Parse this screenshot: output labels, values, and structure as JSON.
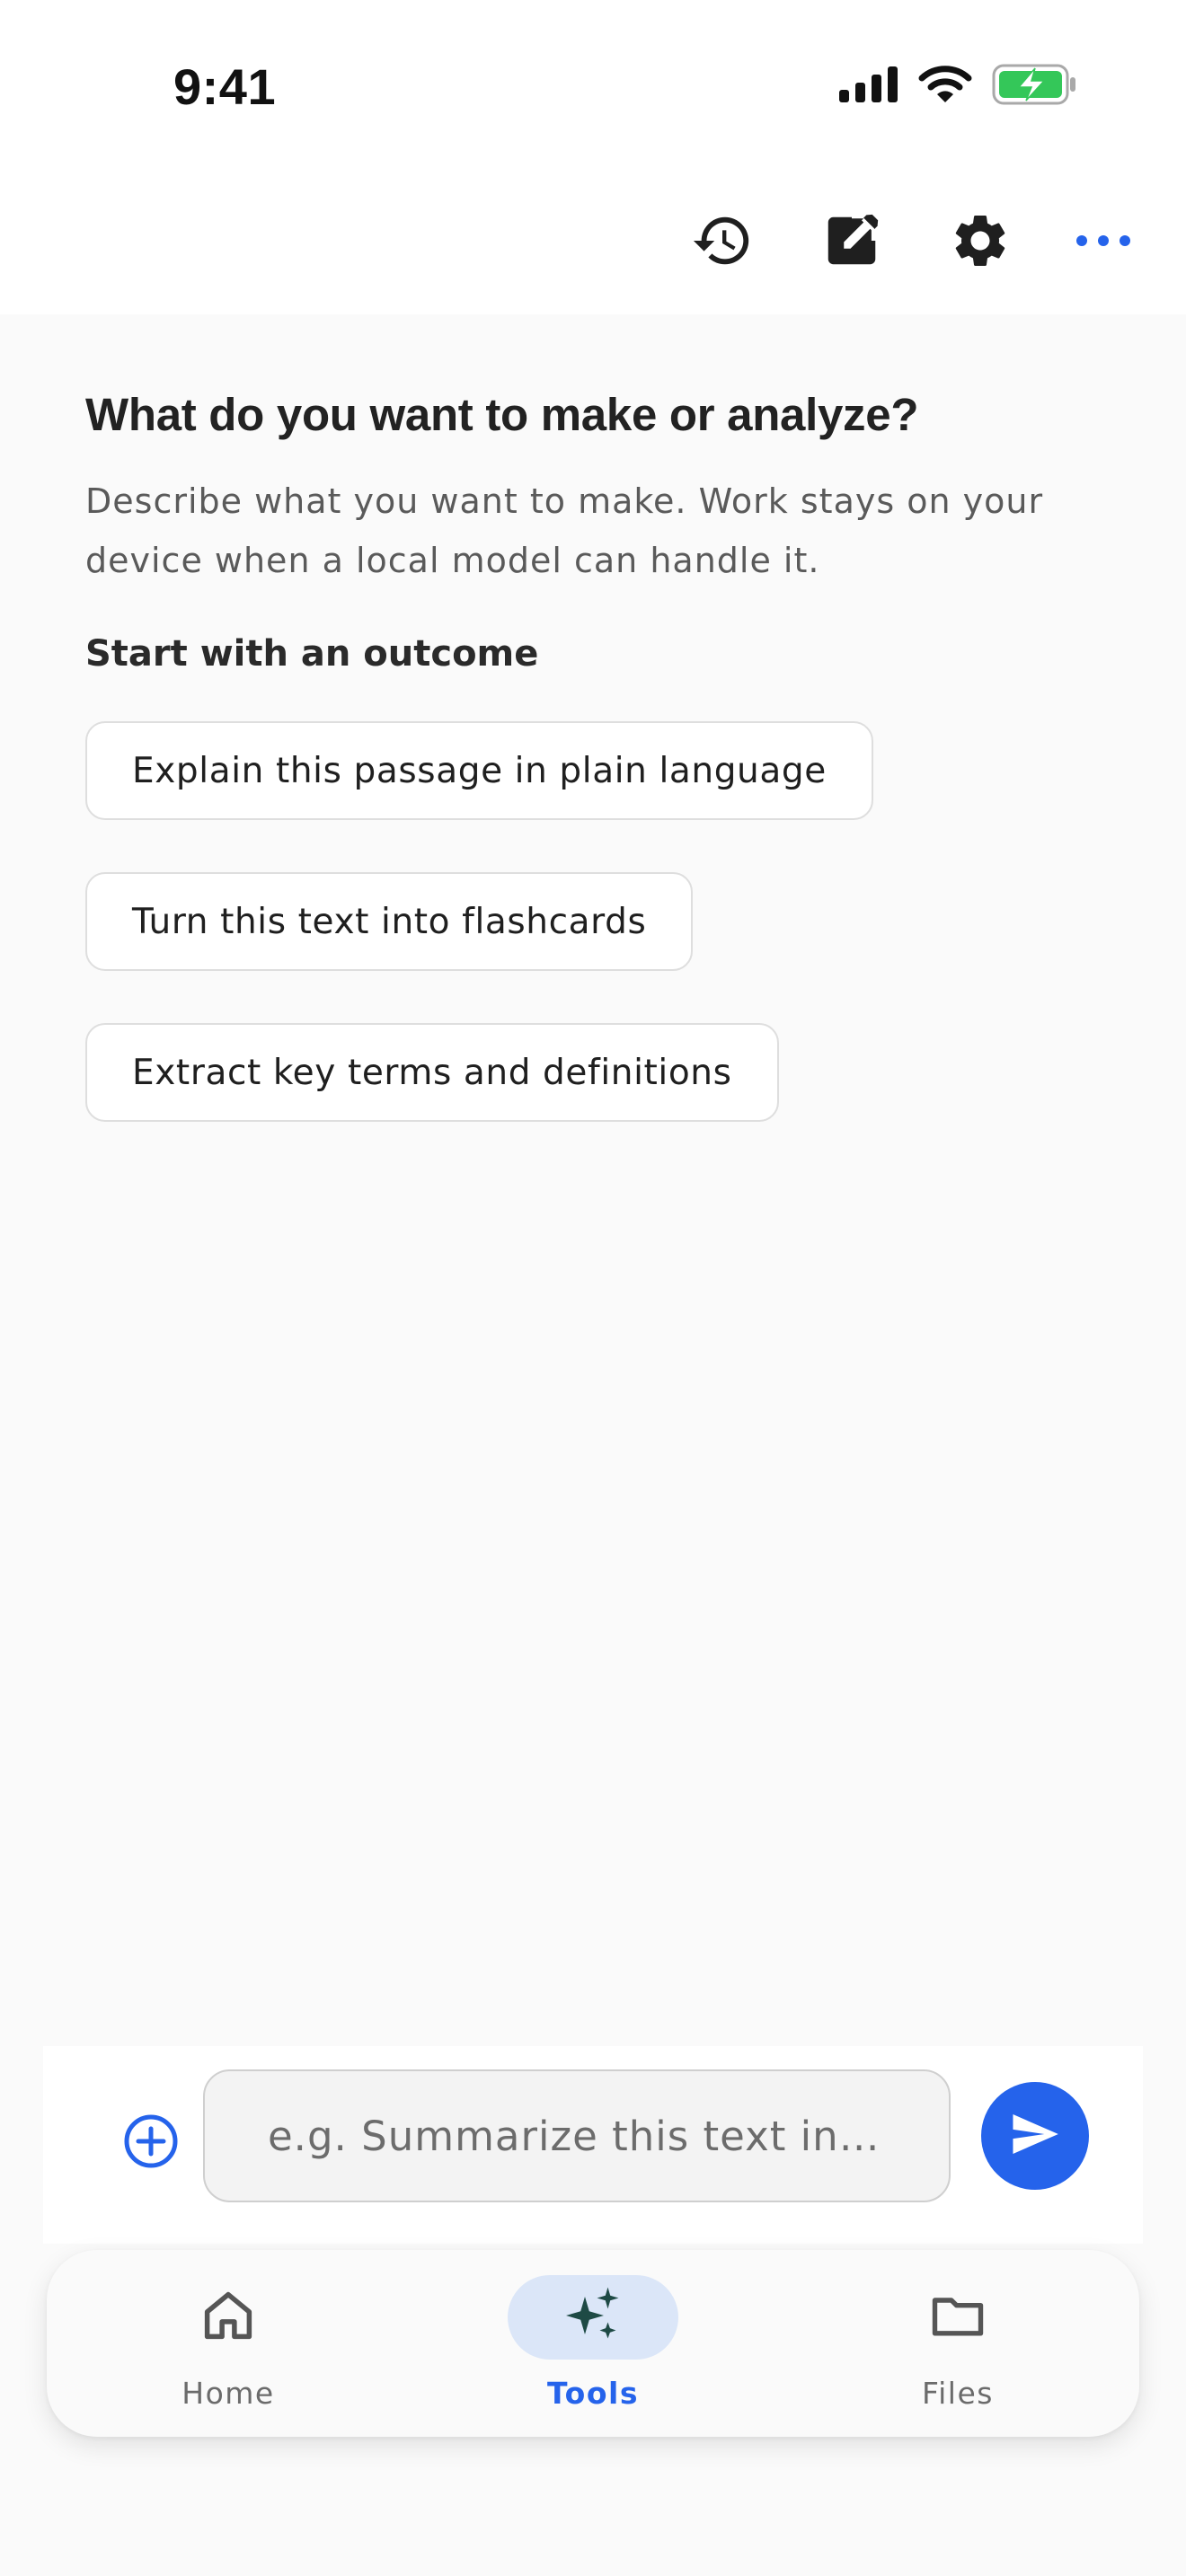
{
  "status_bar": {
    "time": "9:41",
    "icons": [
      "cellular-signal-icon",
      "wifi-icon",
      "battery-charging-icon"
    ]
  },
  "toolbar": {
    "icons": [
      "history-icon",
      "edit-icon",
      "settings-icon",
      "more-icon"
    ]
  },
  "main": {
    "heading": "What do you want to make or analyze?",
    "description": "Describe what you want to make. Work stays on your device when a local model can handle it.",
    "section_label": "Start with an outcome",
    "suggestions": [
      "Explain this passage in plain language",
      "Turn this text into flashcards",
      "Extract key terms and definitions"
    ]
  },
  "composer": {
    "placeholder": "e.g. Summarize this text in…",
    "value": ""
  },
  "bottom_nav": {
    "items": [
      {
        "label": "Home",
        "icon": "home-icon",
        "active": false
      },
      {
        "label": "Tools",
        "icon": "sparkles-icon",
        "active": true
      },
      {
        "label": "Files",
        "icon": "folder-icon",
        "active": false
      }
    ]
  },
  "colors": {
    "accent": "#2563eb",
    "active_pill": "#dbe6f8",
    "background": "#fafafa",
    "sparkle": "#1e4a45",
    "battery": "#34c759"
  }
}
